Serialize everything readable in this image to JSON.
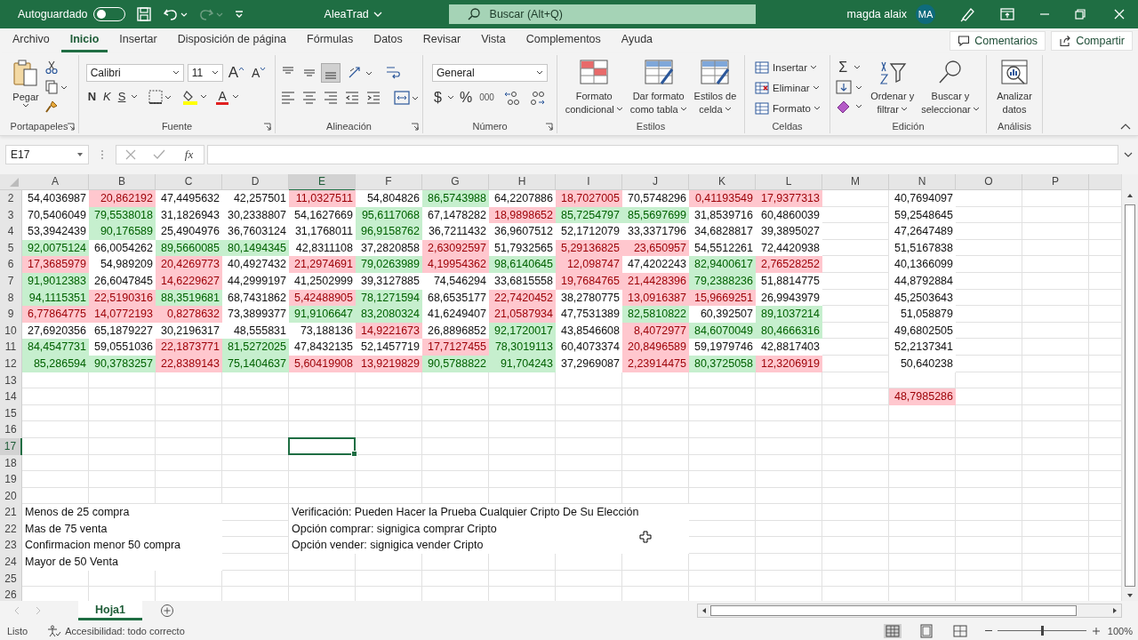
{
  "title_bar": {
    "autosave_label": "Autoguardado",
    "autosave_on": false,
    "document_title": "AleaTrad",
    "search_placeholder": "Buscar (Alt+Q)",
    "user_name": "magda alaix",
    "avatar_initials": "MA"
  },
  "menu_tabs": [
    {
      "label": "Archivo",
      "selected": false
    },
    {
      "label": "Inicio",
      "selected": true
    },
    {
      "label": "Insertar",
      "selected": false
    },
    {
      "label": "Disposición de página",
      "selected": false
    },
    {
      "label": "Fórmulas",
      "selected": false
    },
    {
      "label": "Datos",
      "selected": false
    },
    {
      "label": "Revisar",
      "selected": false
    },
    {
      "label": "Vista",
      "selected": false
    },
    {
      "label": "Complementos",
      "selected": false
    },
    {
      "label": "Ayuda",
      "selected": false
    }
  ],
  "header_buttons": [
    "Comentarios",
    "Compartir"
  ],
  "ribbon_groups": [
    {
      "kind": "clipboard",
      "label": "Portapapeles",
      "paste_label": "Pegar"
    },
    {
      "kind": "font",
      "label": "Fuente",
      "font": "Calibri",
      "size": "11",
      "grow": "A",
      "shrink": "A",
      "bold": "N",
      "italic": "K",
      "underline": "S",
      "font_color": "A"
    },
    {
      "kind": "alignment",
      "label": "Alineación"
    },
    {
      "kind": "number",
      "label": "Número",
      "format": "General",
      "currency": "$",
      "percent": "%",
      "thousands": "000"
    },
    {
      "kind": "styles",
      "label": "Estilos",
      "buttons": [
        {
          "lines": [
            "Formato",
            "condicional"
          ]
        },
        {
          "lines": [
            "Dar formato",
            "como tabla"
          ]
        },
        {
          "lines": [
            "Estilos de",
            "celda"
          ]
        }
      ]
    },
    {
      "kind": "cells",
      "label": "Celdas",
      "buttons": [
        "Insertar",
        "Eliminar",
        "Formato"
      ]
    },
    {
      "kind": "editing",
      "label": "Edición",
      "autosum": "Σ",
      "buttons": [
        {
          "lines": [
            "Ordenar y",
            "filtrar"
          ]
        },
        {
          "lines": [
            "Buscar y",
            "seleccionar"
          ]
        }
      ]
    },
    {
      "kind": "analysis",
      "label": "Análisis",
      "buttons": [
        {
          "lines": [
            "Analizar",
            "datos"
          ]
        }
      ]
    }
  ],
  "formula_bar": {
    "name_box": "E17",
    "function_label": "fx"
  },
  "sheet": {
    "columns": [
      {
        "label": "A",
        "selected": false
      },
      {
        "label": "B",
        "selected": false
      },
      {
        "label": "C",
        "selected": false
      },
      {
        "label": "D",
        "selected": false
      },
      {
        "label": "E",
        "selected": true
      },
      {
        "label": "F",
        "selected": false
      },
      {
        "label": "G",
        "selected": false
      },
      {
        "label": "H",
        "selected": false
      },
      {
        "label": "I",
        "selected": false
      },
      {
        "label": "J",
        "selected": false
      },
      {
        "label": "K",
        "selected": false
      },
      {
        "label": "L",
        "selected": false
      },
      {
        "label": "M",
        "selected": false
      },
      {
        "label": "N",
        "selected": false
      },
      {
        "label": "O",
        "selected": false
      },
      {
        "label": "P",
        "selected": false
      }
    ],
    "rows": [
      {
        "label": "2",
        "selected": false,
        "cells": [
          {
            "value": "54,4036987",
            "color": "#ffffff"
          },
          {
            "value": "20,862192",
            "color": "#ffc7ce"
          },
          {
            "value": "47,4495632",
            "color": "#ffffff"
          },
          {
            "value": "42,257501",
            "color": "#ffffff"
          },
          {
            "value": "11,0327511",
            "color": "#ffc7ce"
          },
          {
            "value": "54,804826",
            "color": "#ffffff"
          },
          {
            "value": "86,5743988",
            "color": "#c6efce"
          },
          {
            "value": "64,2207886",
            "color": "#ffffff"
          },
          {
            "value": "18,7027005",
            "color": "#ffc7ce"
          },
          {
            "value": "70,5748296",
            "color": "#ffffff"
          },
          {
            "value": "0,41193549",
            "color": "#ffc7ce"
          },
          {
            "value": "17,9377313",
            "color": "#ffc7ce"
          }
        ],
        "column_n": {
          "value": "40,7694097",
          "color": "#ffffff"
        }
      },
      {
        "label": "3",
        "selected": false,
        "cells": [
          {
            "value": "70,5406049",
            "color": "#ffffff"
          },
          {
            "value": "79,5538018",
            "color": "#c6efce"
          },
          {
            "value": "31,1826943",
            "color": "#ffffff"
          },
          {
            "value": "30,2338807",
            "color": "#ffffff"
          },
          {
            "value": "54,1627669",
            "color": "#ffffff"
          },
          {
            "value": "95,6117068",
            "color": "#c6efce"
          },
          {
            "value": "67,1478282",
            "color": "#ffffff"
          },
          {
            "value": "18,9898652",
            "color": "#ffc7ce"
          },
          {
            "value": "85,7254797",
            "color": "#c6efce"
          },
          {
            "value": "85,5697699",
            "color": "#c6efce"
          },
          {
            "value": "31,8539716",
            "color": "#ffffff"
          },
          {
            "value": "60,4860039",
            "color": "#ffffff"
          }
        ],
        "column_n": {
          "value": "59,2548645",
          "color": "#ffffff"
        }
      },
      {
        "label": "4",
        "selected": false,
        "cells": [
          {
            "value": "53,3942439",
            "color": "#ffffff"
          },
          {
            "value": "90,176589",
            "color": "#c6efce"
          },
          {
            "value": "25,4904976",
            "color": "#ffffff"
          },
          {
            "value": "36,7603124",
            "color": "#ffffff"
          },
          {
            "value": "31,1768011",
            "color": "#ffffff"
          },
          {
            "value": "96,9158762",
            "color": "#c6efce"
          },
          {
            "value": "36,7211432",
            "color": "#ffffff"
          },
          {
            "value": "36,9607512",
            "color": "#ffffff"
          },
          {
            "value": "52,1712079",
            "color": "#ffffff"
          },
          {
            "value": "33,3371796",
            "color": "#ffffff"
          },
          {
            "value": "34,6828817",
            "color": "#ffffff"
          },
          {
            "value": "39,3895027",
            "color": "#ffffff"
          }
        ],
        "column_n": {
          "value": "47,2647489",
          "color": "#ffffff"
        }
      },
      {
        "label": "5",
        "selected": false,
        "cells": [
          {
            "value": "92,0075124",
            "color": "#c6efce"
          },
          {
            "value": "66,0054262",
            "color": "#ffffff"
          },
          {
            "value": "89,5660085",
            "color": "#c6efce"
          },
          {
            "value": "80,1494345",
            "color": "#c6efce"
          },
          {
            "value": "42,8311108",
            "color": "#ffffff"
          },
          {
            "value": "37,2820858",
            "color": "#ffffff"
          },
          {
            "value": "2,63092597",
            "color": "#ffc7ce"
          },
          {
            "value": "51,7932565",
            "color": "#ffffff"
          },
          {
            "value": "5,29136825",
            "color": "#ffc7ce"
          },
          {
            "value": "23,650957",
            "color": "#ffc7ce"
          },
          {
            "value": "54,5512261",
            "color": "#ffffff"
          },
          {
            "value": "72,4420938",
            "color": "#ffffff"
          }
        ],
        "column_n": {
          "value": "51,5167838",
          "color": "#ffffff"
        }
      },
      {
        "label": "6",
        "selected": false,
        "cells": [
          {
            "value": "17,3685979",
            "color": "#ffc7ce"
          },
          {
            "value": "54,989209",
            "color": "#ffffff"
          },
          {
            "value": "20,4269773",
            "color": "#ffc7ce"
          },
          {
            "value": "40,4927432",
            "color": "#ffffff"
          },
          {
            "value": "21,2974691",
            "color": "#ffc7ce"
          },
          {
            "value": "79,0263989",
            "color": "#c6efce"
          },
          {
            "value": "4,19954362",
            "color": "#ffc7ce"
          },
          {
            "value": "98,6140645",
            "color": "#c6efce"
          },
          {
            "value": "12,098747",
            "color": "#ffc7ce"
          },
          {
            "value": "47,4202243",
            "color": "#ffffff"
          },
          {
            "value": "82,9400617",
            "color": "#c6efce"
          },
          {
            "value": "2,76528252",
            "color": "#ffc7ce"
          }
        ],
        "column_n": {
          "value": "40,1366099",
          "color": "#ffffff"
        }
      },
      {
        "label": "7",
        "selected": false,
        "cells": [
          {
            "value": "91,9012383",
            "color": "#c6efce"
          },
          {
            "value": "26,6047845",
            "color": "#ffffff"
          },
          {
            "value": "14,6229627",
            "color": "#ffc7ce"
          },
          {
            "value": "44,2999197",
            "color": "#ffffff"
          },
          {
            "value": "41,2502999",
            "color": "#ffffff"
          },
          {
            "value": "39,3127885",
            "color": "#ffffff"
          },
          {
            "value": "74,546294",
            "color": "#ffffff"
          },
          {
            "value": "33,6815558",
            "color": "#ffffff"
          },
          {
            "value": "19,7684765",
            "color": "#ffc7ce"
          },
          {
            "value": "21,4428396",
            "color": "#ffc7ce"
          },
          {
            "value": "79,2388236",
            "color": "#c6efce"
          },
          {
            "value": "51,8814775",
            "color": "#ffffff"
          }
        ],
        "column_n": {
          "value": "44,8792884",
          "color": "#ffffff"
        }
      },
      {
        "label": "8",
        "selected": false,
        "cells": [
          {
            "value": "94,1115351",
            "color": "#c6efce"
          },
          {
            "value": "22,5190316",
            "color": "#ffc7ce"
          },
          {
            "value": "88,3519681",
            "color": "#c6efce"
          },
          {
            "value": "68,7431862",
            "color": "#ffffff"
          },
          {
            "value": "5,42488905",
            "color": "#ffc7ce"
          },
          {
            "value": "78,1271594",
            "color": "#c6efce"
          },
          {
            "value": "68,6535177",
            "color": "#ffffff"
          },
          {
            "value": "22,7420452",
            "color": "#ffc7ce"
          },
          {
            "value": "38,2780775",
            "color": "#ffffff"
          },
          {
            "value": "13,0916387",
            "color": "#ffc7ce"
          },
          {
            "value": "15,9669251",
            "color": "#ffc7ce"
          },
          {
            "value": "26,9943979",
            "color": "#ffffff"
          }
        ],
        "column_n": {
          "value": "45,2503643",
          "color": "#ffffff"
        }
      },
      {
        "label": "9",
        "selected": false,
        "cells": [
          {
            "value": "6,77864775",
            "color": "#ffc7ce"
          },
          {
            "value": "14,0772193",
            "color": "#ffc7ce"
          },
          {
            "value": "0,8278632",
            "color": "#ffc7ce"
          },
          {
            "value": "73,3899377",
            "color": "#ffffff"
          },
          {
            "value": "91,9106647",
            "color": "#c6efce"
          },
          {
            "value": "83,2080324",
            "color": "#c6efce"
          },
          {
            "value": "41,6249407",
            "color": "#ffffff"
          },
          {
            "value": "21,0587934",
            "color": "#ffc7ce"
          },
          {
            "value": "47,7531389",
            "color": "#ffffff"
          },
          {
            "value": "82,5810822",
            "color": "#c6efce"
          },
          {
            "value": "60,392507",
            "color": "#ffffff"
          },
          {
            "value": "89,1037214",
            "color": "#c6efce"
          }
        ],
        "column_n": {
          "value": "51,058879",
          "color": "#ffffff"
        }
      },
      {
        "label": "10",
        "selected": false,
        "cells": [
          {
            "value": "27,6920356",
            "color": "#ffffff"
          },
          {
            "value": "65,1879227",
            "color": "#ffffff"
          },
          {
            "value": "30,2196317",
            "color": "#ffffff"
          },
          {
            "value": "48,555831",
            "color": "#ffffff"
          },
          {
            "value": "73,188136",
            "color": "#ffffff"
          },
          {
            "value": "14,9221673",
            "color": "#ffc7ce"
          },
          {
            "value": "26,8896852",
            "color": "#ffffff"
          },
          {
            "value": "92,1720017",
            "color": "#c6efce"
          },
          {
            "value": "43,8546608",
            "color": "#ffffff"
          },
          {
            "value": "8,4072977",
            "color": "#ffc7ce"
          },
          {
            "value": "84,6070049",
            "color": "#c6efce"
          },
          {
            "value": "80,4666316",
            "color": "#c6efce"
          }
        ],
        "column_n": {
          "value": "49,6802505",
          "color": "#ffffff"
        }
      },
      {
        "label": "11",
        "selected": false,
        "cells": [
          {
            "value": "84,4547731",
            "color": "#c6efce"
          },
          {
            "value": "59,0551036",
            "color": "#ffffff"
          },
          {
            "value": "22,1873771",
            "color": "#ffc7ce"
          },
          {
            "value": "81,5272025",
            "color": "#c6efce"
          },
          {
            "value": "47,8432135",
            "color": "#ffffff"
          },
          {
            "value": "52,1457719",
            "color": "#ffffff"
          },
          {
            "value": "17,7127455",
            "color": "#ffc7ce"
          },
          {
            "value": "78,3019113",
            "color": "#c6efce"
          },
          {
            "value": "60,4073374",
            "color": "#ffffff"
          },
          {
            "value": "20,8496589",
            "color": "#ffc7ce"
          },
          {
            "value": "59,1979746",
            "color": "#ffffff"
          },
          {
            "value": "42,8817403",
            "color": "#ffffff"
          }
        ],
        "column_n": {
          "value": "52,2137341",
          "color": "#ffffff"
        }
      },
      {
        "label": "12",
        "selected": false,
        "cells": [
          {
            "value": "85,286594",
            "color": "#c6efce"
          },
          {
            "value": "90,3783257",
            "color": "#c6efce"
          },
          {
            "value": "22,8389143",
            "color": "#ffc7ce"
          },
          {
            "value": "75,1404637",
            "color": "#c6efce"
          },
          {
            "value": "5,60419908",
            "color": "#ffc7ce"
          },
          {
            "value": "13,9219829",
            "color": "#ffc7ce"
          },
          {
            "value": "90,5788822",
            "color": "#c6efce"
          },
          {
            "value": "91,704243",
            "color": "#c6efce"
          },
          {
            "value": "37,2969087",
            "color": "#ffffff"
          },
          {
            "value": "2,23914475",
            "color": "#ffc7ce"
          },
          {
            "value": "80,3725058",
            "color": "#c6efce"
          },
          {
            "value": "12,3206919",
            "color": "#ffc7ce"
          }
        ],
        "column_n": {
          "value": "50,640238",
          "color": "#ffffff"
        }
      },
      {
        "label": "13",
        "selected": false
      },
      {
        "label": "14",
        "selected": false,
        "column_n": {
          "value": "48,7985286",
          "color": "#ffc7ce"
        }
      },
      {
        "label": "15",
        "selected": false
      },
      {
        "label": "16",
        "selected": false
      },
      {
        "label": "17",
        "selected": true
      },
      {
        "label": "18",
        "selected": false
      },
      {
        "label": "19",
        "selected": false
      },
      {
        "label": "20",
        "selected": false
      },
      {
        "label": "21",
        "selected": false,
        "column_a_text": "Menos de 25 compra",
        "column_e_text": "Verificación: Pueden Hacer la Prueba Cualquier  Cripto De Su Elección"
      },
      {
        "label": "22",
        "selected": false,
        "column_a_text": "Mas de 75 venta",
        "column_e_text": "Opción comprar: signigica comprar Cripto"
      },
      {
        "label": "23",
        "selected": false,
        "column_a_text": "Confirmacion menor 50 compra",
        "column_e_text": "Opción vender: signigica vender Cripto"
      },
      {
        "label": "24",
        "selected": false,
        "column_a_text": "Mayor de 50 Venta"
      },
      {
        "label": "25",
        "selected": false
      },
      {
        "label": "26",
        "selected": false
      }
    ]
  },
  "sheet_tabs": [
    {
      "label": "Hoja1",
      "selected": true
    }
  ],
  "status_bar": {
    "mode": "Listo",
    "accessibility": "Accesibilidad: todo correcto",
    "zoom": "100%",
    "zoom_slider": {
      "level": 0.5
    }
  }
}
